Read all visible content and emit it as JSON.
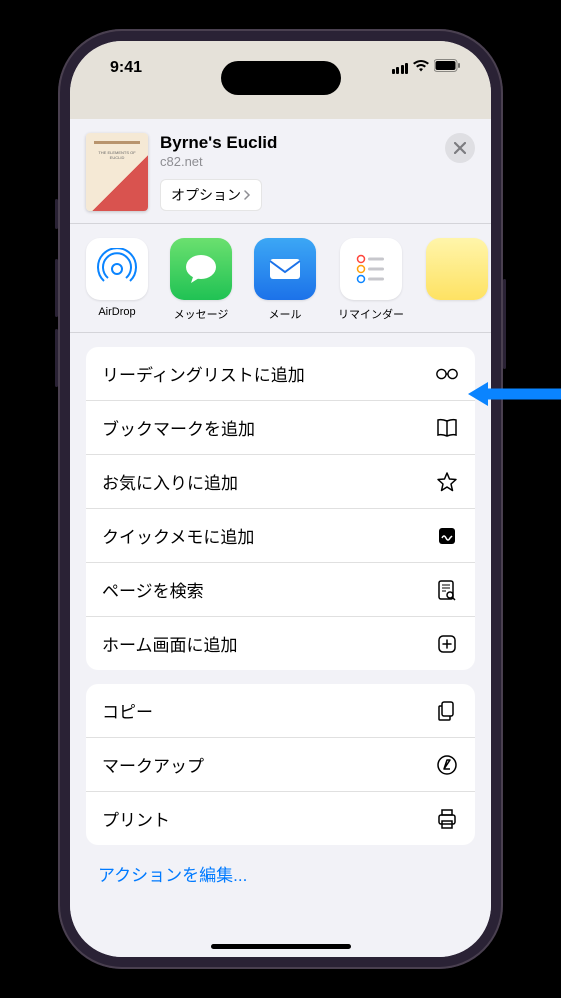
{
  "status": {
    "time": "9:41"
  },
  "header": {
    "title": "Byrne's Euclid",
    "subtitle": "c82.net",
    "options_label": "オプション"
  },
  "apps": [
    {
      "name": "airdrop",
      "label": "AirDrop"
    },
    {
      "name": "messages",
      "label": "メッセージ"
    },
    {
      "name": "mail",
      "label": "メール"
    },
    {
      "name": "reminders",
      "label": "リマインダー"
    },
    {
      "name": "notes",
      "label": ""
    }
  ],
  "actions_group1": [
    {
      "label": "リーディングリストに追加",
      "icon": "glasses"
    },
    {
      "label": "ブックマークを追加",
      "icon": "book"
    },
    {
      "label": "お気に入りに追加",
      "icon": "star"
    },
    {
      "label": "クイックメモに追加",
      "icon": "note"
    },
    {
      "label": "ページを検索",
      "icon": "doc-search"
    },
    {
      "label": "ホーム画面に追加",
      "icon": "plus-square"
    }
  ],
  "actions_group2": [
    {
      "label": "コピー",
      "icon": "docs"
    },
    {
      "label": "マークアップ",
      "icon": "markup"
    },
    {
      "label": "プリント",
      "icon": "print"
    }
  ],
  "footer": {
    "edit_label": "アクションを編集..."
  }
}
